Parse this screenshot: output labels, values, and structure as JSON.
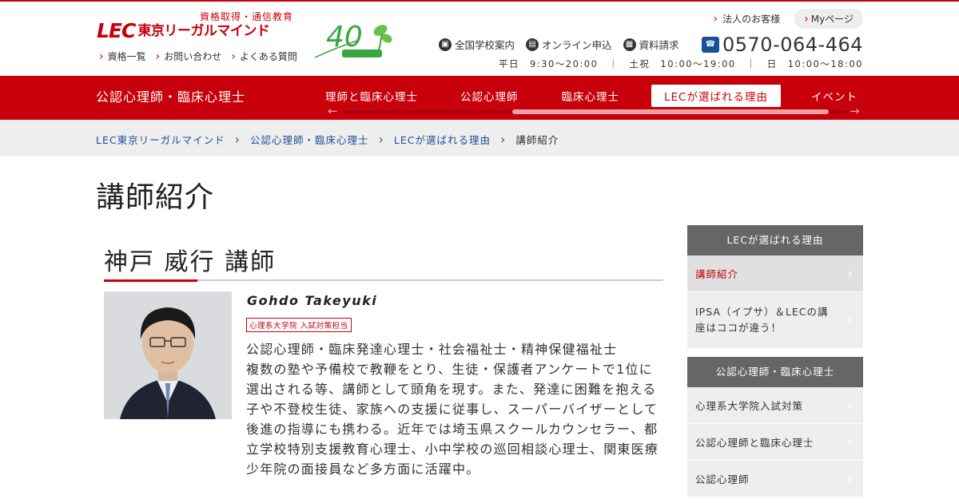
{
  "header": {
    "tagline": "資格取得・通信教育",
    "logo_mark": "LEC",
    "logo_name": "東京リーガルマインド",
    "anniv_number": "40",
    "top_links": [
      "資格一覧",
      "お問い合わせ",
      "よくある質問"
    ],
    "corp_link": "法人のお客様",
    "mypage": "Myページ",
    "quick_links": [
      "全国学校案内",
      "オンライン申込",
      "資料請求"
    ],
    "phone": "0570-064-464",
    "hours": "平日　9:30～20:00　｜　土祝　10:00～19:00　｜　日　10:00～18:00"
  },
  "nav": {
    "title": "公認心理師・臨床心理士",
    "items": [
      "理師と臨床心理士",
      "公認心理師",
      "臨床心理士",
      "LECが選ばれる理由",
      "イベント"
    ],
    "active_index": 3
  },
  "breadcrumb": [
    "LEC東京リーガルマインド",
    "公認心理師・臨床心理士",
    "LECが選ばれる理由",
    "講師紹介"
  ],
  "page_title": "講師紹介",
  "instructor": {
    "name": "神戸 威行 講師",
    "roman_name": "Gohdo Takeyuki",
    "tag": "心理系大学院 入試対策担当",
    "profile_lines": [
      "公認心理師・臨床発達心理士・社会福祉士・精神保健福祉士",
      "複数の塾や予備校で教鞭をとり、生徒・保護者アンケートで1位に選出される等、講師として頭角を現す。また、発達に困難を抱える子や不登校生徒、家族への支援に従事し、スーパーバイザーとして後進の指導にも携わる。近年では埼玉県スクールカウンセラー、都立学校特別支援教育心理士、小中学校の巡回相談心理士、関東医療少年院の面接員など多方面に活躍中。"
    ]
  },
  "sidebar": {
    "section1": {
      "head": "LECが選ばれる理由",
      "items": [
        "講師紹介",
        "IPSA（イプサ）＆LECの講座はココが違う！"
      ]
    },
    "section2": {
      "head": "公認心理師・臨床心理士",
      "items": [
        "心理系大学院入試対策",
        "公認心理師と臨床心理士",
        "公認心理師"
      ]
    }
  },
  "colors": {
    "brand_red": "#c8000b",
    "breadcrumb_bg": "#eeeeee",
    "sidebar_head": "#666666"
  }
}
